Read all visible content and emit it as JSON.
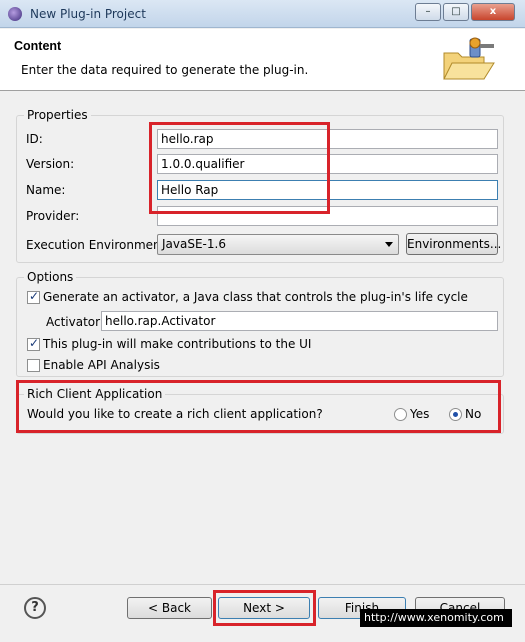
{
  "window": {
    "title": "New Plug-in Project",
    "min": "–",
    "max": "□",
    "close": "x"
  },
  "header": {
    "title": "Content",
    "description": "Enter the data required to generate the plug-in."
  },
  "properties": {
    "group_title": "Properties",
    "id_label": "ID:",
    "id_value": "hello.rap",
    "version_label": "Version:",
    "version_value": "1.0.0.qualifier",
    "name_label": "Name:",
    "name_value": "Hello Rap",
    "provider_label": "Provider:",
    "provider_value": "",
    "env_label": "Execution Environment:",
    "env_value": "JavaSE-1.6",
    "env_button": "Environments..."
  },
  "options": {
    "group_title": "Options",
    "activator_check": "Generate an activator, a Java class that controls the plug-in's life cycle",
    "activator_label": "Activator:",
    "activator_value": "hello.rap.Activator",
    "ui_check": "This plug-in will make contributions to the UI",
    "api_check": "Enable API Analysis"
  },
  "rca": {
    "group_title": "Rich Client Application",
    "question": "Would you like to create a rich client application?",
    "yes": "Yes",
    "no": "No",
    "selected": "No"
  },
  "buttons": {
    "help": "?",
    "back": "< Back",
    "next": "Next >",
    "finish": "Finish",
    "cancel": "Cancel"
  },
  "watermark": "http://www.xenomity.com",
  "colors": {
    "highlight": "#d8232a"
  }
}
